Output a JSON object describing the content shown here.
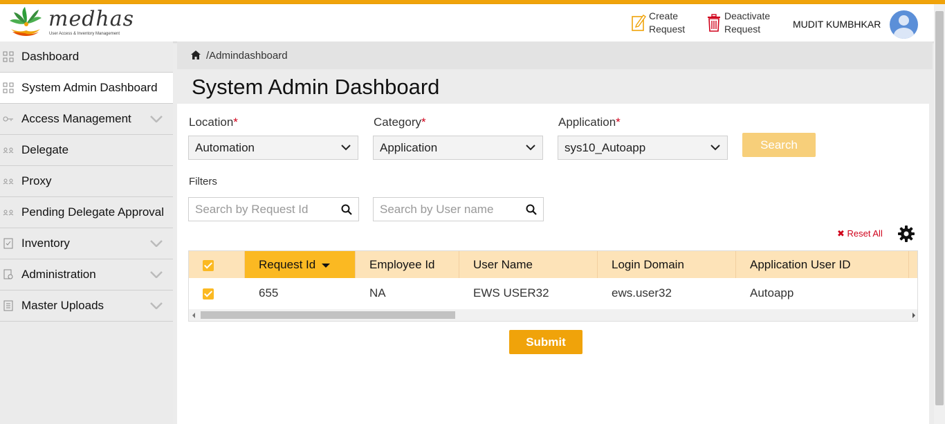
{
  "header": {
    "logo_text": "medhas",
    "logo_subtitle": "User Access & Inventory Management",
    "create_request_label": "Create Request",
    "deactivate_request_label": "Deactivate Request",
    "user_name": "MUDIT KUMBHKAR",
    "accent_color": "#f0a30a"
  },
  "sidebar": {
    "items": [
      {
        "label": "Dashboard",
        "icon": "grid-icon",
        "expandable": false
      },
      {
        "label": "System Admin Dashboard",
        "icon": "grid-icon",
        "expandable": false,
        "active": true
      },
      {
        "label": "Access Management",
        "icon": "key-icon",
        "expandable": true
      },
      {
        "label": "Delegate",
        "icon": "users-icon",
        "expandable": false
      },
      {
        "label": "Proxy",
        "icon": "users-icon",
        "expandable": false
      },
      {
        "label": "Pending Delegate Approval",
        "icon": "users-icon",
        "expandable": false
      },
      {
        "label": "Inventory",
        "icon": "checklist-icon",
        "expandable": true
      },
      {
        "label": "Administration",
        "icon": "document-gear-icon",
        "expandable": true
      },
      {
        "label": "Master Uploads",
        "icon": "document-icon",
        "expandable": true
      }
    ]
  },
  "breadcrumb": "/Admindashboard",
  "page_title": "System Admin Dashboard",
  "form": {
    "location_label": "Location",
    "location_value": "Automation",
    "category_label": "Category",
    "category_value": "Application",
    "application_label": "Application",
    "application_value": "sys10_Autoapp",
    "required_mark": "*",
    "search_button": "Search",
    "filters_label": "Filters",
    "search_request_placeholder": "Search by Request Id",
    "search_user_placeholder": "Search by User name",
    "reset_all": "Reset All"
  },
  "table": {
    "columns": [
      "Request Id",
      "Employee Id",
      "User Name",
      "Login Domain",
      "Application User ID"
    ],
    "rows": [
      {
        "request_id": "655",
        "employee_id": "NA",
        "user_name": "EWS USER32",
        "login_domain": "ews.user32",
        "app_user_id": "Autoapp",
        "checked": true
      }
    ]
  },
  "submit_button": "Submit"
}
